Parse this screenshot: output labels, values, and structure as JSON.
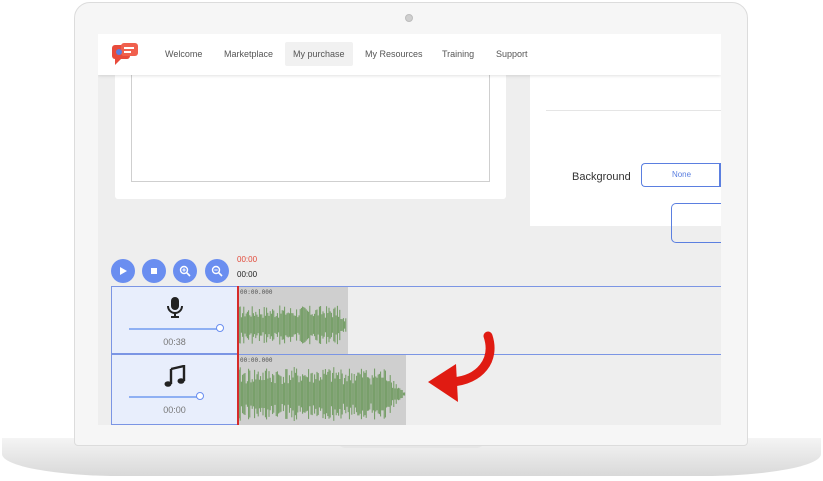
{
  "nav": {
    "items": [
      "Welcome",
      "Marketplace",
      "My purchase",
      "My Resources",
      "Training",
      "Support"
    ],
    "active": "My purchase"
  },
  "settings": {
    "background_label": "Background",
    "background_option": "None"
  },
  "timeline": {
    "time_current": "00:00",
    "time_total": "00:00",
    "tracks": [
      {
        "type": "voice",
        "icon": "microphone-icon",
        "duration": "00:38",
        "clip_start": "00:00.000"
      },
      {
        "type": "music",
        "icon": "music-note-icon",
        "duration": "00:00",
        "clip_start": "00:00.000"
      }
    ]
  },
  "colors": {
    "accent": "#6a8ef0",
    "playhead": "#d62b2b",
    "waveform": "#6f9a5f",
    "arrow": "#e01b12"
  }
}
